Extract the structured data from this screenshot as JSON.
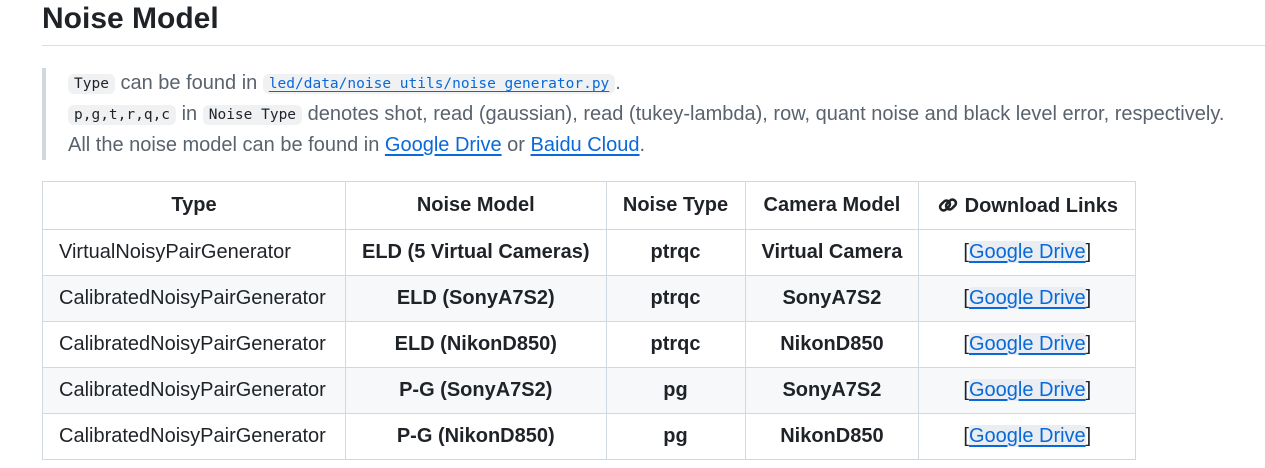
{
  "heading": "Noise Model",
  "note": {
    "line1": {
      "code_type": "Type",
      "text_found": "can be found in",
      "path": "led/data/noise_utils/noise_generator.py",
      "end": "."
    },
    "line2": {
      "code_letters": "p,g,t,r,q,c",
      "text_in": "in",
      "code_noise_type": "Noise Type",
      "text_desc": "denotes shot, read (gaussian), read (tukey-lambda), row, quant noise and black level error, respectively."
    },
    "line3": {
      "text_all": "All the noise model can be found in",
      "google": "Google Drive",
      "or": "or",
      "baidu": "Baidu Cloud",
      "end": "."
    }
  },
  "table": {
    "headers": {
      "type": "Type",
      "model": "Noise Model",
      "ntype": "Noise Type",
      "camera": "Camera Model",
      "download": "Download Links"
    },
    "rows": [
      {
        "type": "VirtualNoisyPairGenerator",
        "model": "ELD (5 Virtual Cameras)",
        "ntype": "ptrqc",
        "camera": "Virtual Camera",
        "lb": "[",
        "link": "Google Drive",
        "rb": "]"
      },
      {
        "type": "CalibratedNoisyPairGenerator",
        "model": "ELD (SonyA7S2)",
        "ntype": "ptrqc",
        "camera": "SonyA7S2",
        "lb": "[",
        "link": "Google Drive",
        "rb": "]"
      },
      {
        "type": "CalibratedNoisyPairGenerator",
        "model": "ELD (NikonD850)",
        "ntype": "ptrqc",
        "camera": "NikonD850",
        "lb": "[",
        "link": "Google Drive",
        "rb": "]"
      },
      {
        "type": "CalibratedNoisyPairGenerator",
        "model": "P-G (SonyA7S2)",
        "ntype": "pg",
        "camera": "SonyA7S2",
        "lb": "[",
        "link": "Google Drive",
        "rb": "]"
      },
      {
        "type": "CalibratedNoisyPairGenerator",
        "model": "P-G (NikonD850)",
        "ntype": "pg",
        "camera": "NikonD850",
        "lb": "[",
        "link": "Google Drive",
        "rb": "]"
      }
    ]
  },
  "icons": {
    "download_header": "link-chain-icon"
  },
  "colors": {
    "link": "#0969da",
    "text": "#1f2328",
    "muted": "#59636e",
    "border": "#d1d9e0"
  }
}
